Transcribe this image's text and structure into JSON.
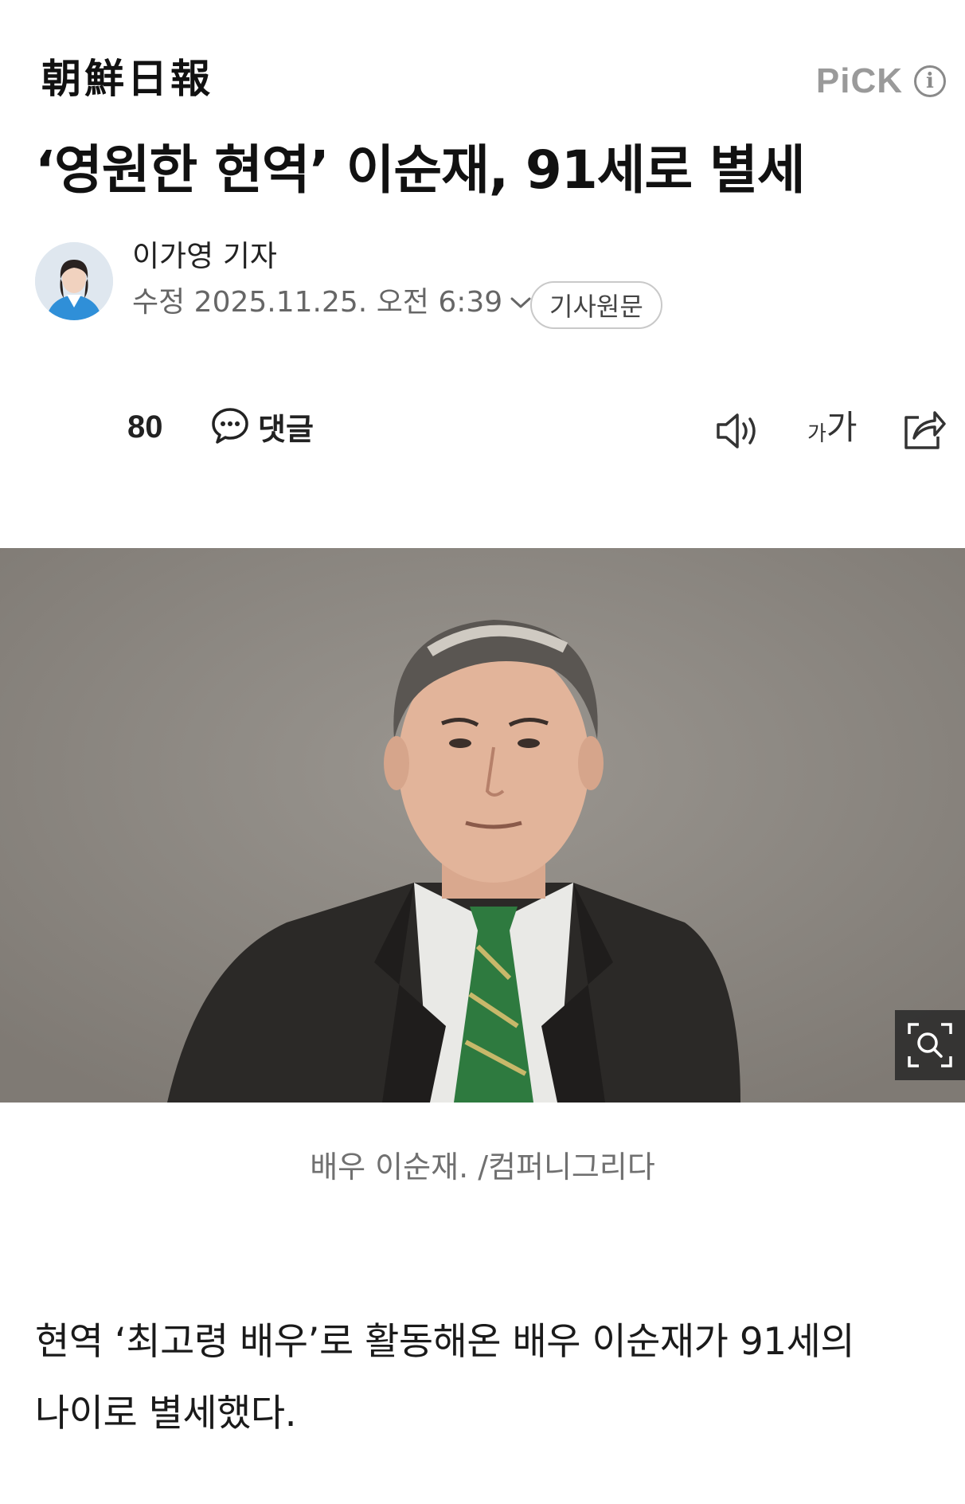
{
  "header": {
    "masthead": "朝鮮日報",
    "pick_label": "PiCK",
    "info_icon": "info-icon"
  },
  "article": {
    "headline": "‘영원한 현역’ 이순재, 91세로 별세",
    "byline": {
      "reporter": "이가영 기자",
      "updated": "수정 2025.11.25. 오전 6:39",
      "original_button": "기사원문"
    },
    "actions": {
      "reaction_count": "80",
      "comment_label": "댓글",
      "font_size_small": "가",
      "font_size_big": "가",
      "icons": [
        "comment-icon",
        "speaker-icon",
        "share-icon"
      ]
    },
    "photo": {
      "caption": "배우 이순재. /컴퍼니그리다",
      "zoom_icon": "zoom-icon"
    },
    "body": "현역 ‘최고령 배우’로 활동해온 배우 이순재가 91세의 나이로 별세했다."
  },
  "colors": {
    "text": "#111111",
    "muted": "#707070",
    "pick": "#9a9a9a",
    "photo_bg": "#8a8580"
  }
}
